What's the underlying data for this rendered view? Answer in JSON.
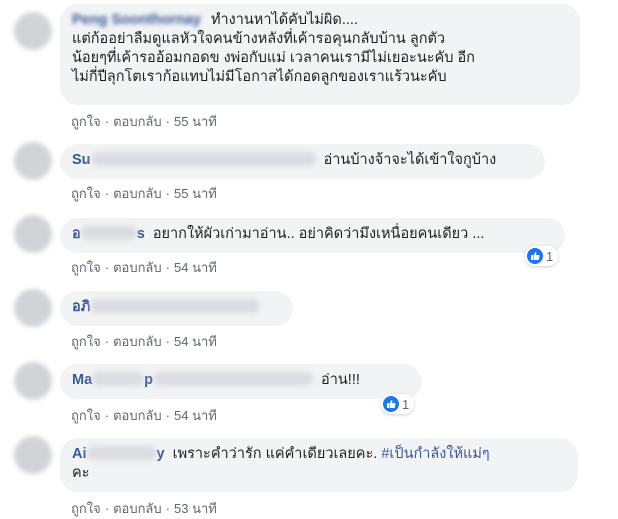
{
  "actions": {
    "like": "ถูกใจ",
    "reply": "ตอบกลับ",
    "separator": "·"
  },
  "comments": [
    {
      "author": "Peng Soonthornay",
      "text": "ทำงานหาได้คับไม่ผิด....",
      "lines": [
        "แต่ก้ออย่าลืมดูแลหัวใจคนข้างหลังที่เค้ารอคุนกลับบ้าน ลูกตัว",
        "น้อยๆที่เค้ารออ้อมกอดข งพ่อกับแม่ เวลาคนเรามีไม่เยอะนะคับ อีก",
        "ไม่กี่ปีลุกโตเราก้อแทบไม่มีโอกาสได้กอดลูกของเราแร้วนะคับ"
      ],
      "time": "55 นาที"
    },
    {
      "author": "Su",
      "text": "อ่านบ้างจ้าจะได้เข้าใจกูบ้าง",
      "time": "55 นาที"
    },
    {
      "author": "อ",
      "author_tail": "s",
      "text": "อยากให้ผัวเก่ามาอ่าน.. อย่าคิดว่ามึงเหนื่อยคนเดียว ...",
      "time": "54 นาที",
      "reactions": "1"
    },
    {
      "author": "อภิ",
      "text": "",
      "time": "54 นาที"
    },
    {
      "author": "Ma",
      "author_tail": "p",
      "text": "อ่าน!!!",
      "time": "54 นาที",
      "reactions": "1"
    },
    {
      "author": "Ai",
      "author_tail": "y",
      "text": "เพราะคำว่ารัก แค่คำเดียวเลยคะ.",
      "hashtag": "#เป็นกำลังให้แม่ๆ",
      "text_line2": "คะ",
      "time": "53 นาที"
    }
  ],
  "colors": {
    "author": "#385898",
    "bubble": "#f2f3f5",
    "like": "#1877f2"
  }
}
